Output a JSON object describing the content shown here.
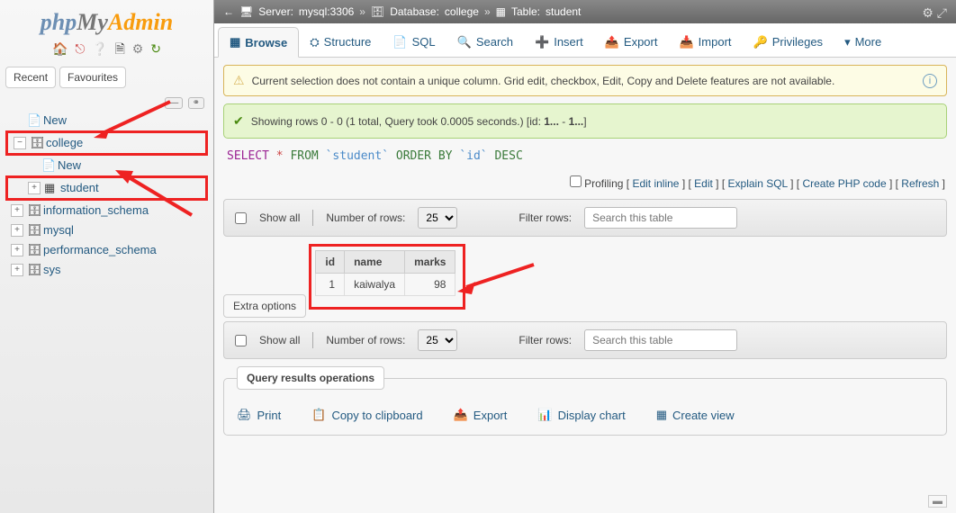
{
  "logo": {
    "p1": "php",
    "p2": "My",
    "p3": "Admin"
  },
  "sidebar_tabs": {
    "recent": "Recent",
    "favourites": "Favourites"
  },
  "tree": {
    "new": "New",
    "college": "college",
    "college_new": "New",
    "student": "student",
    "info_schema": "information_schema",
    "mysql": "mysql",
    "perf_schema": "performance_schema",
    "sys": "sys"
  },
  "breadcrumb": {
    "server_label": "Server:",
    "server_value": "mysql:3306",
    "db_label": "Database:",
    "db_value": "college",
    "tbl_label": "Table:",
    "tbl_value": "student",
    "sep": "»"
  },
  "tabs": {
    "browse": "Browse",
    "structure": "Structure",
    "sql": "SQL",
    "search": "Search",
    "insert": "Insert",
    "export": "Export",
    "import": "Import",
    "privileges": "Privileges",
    "more": "More"
  },
  "warn_msg": "Current selection does not contain a unique column. Grid edit, checkbox, Edit, Copy and Delete features are not available.",
  "ok_msg": {
    "pre": "Showing rows 0 - 0 (1 total, Query took 0.0005 seconds.) [id: ",
    "b1": "1...",
    "mid": " - ",
    "b2": "1...",
    "post": "]"
  },
  "sql": {
    "select": "SELECT",
    "star": "*",
    "from": "FROM",
    "tbl": "`student`",
    "orderby": "ORDER BY",
    "col": "`id`",
    "desc": "DESC"
  },
  "links": {
    "profiling": "Profiling",
    "edit_inline": "Edit inline",
    "edit": "Edit",
    "explain": "Explain SQL",
    "php": "Create PHP code",
    "refresh": "Refresh"
  },
  "controls": {
    "show_all": "Show all",
    "num_rows": "Number of rows:",
    "rows_val": "25",
    "filter_label": "Filter rows:",
    "filter_ph": "Search this table"
  },
  "extra_options": "Extra options",
  "table": {
    "headers": [
      "id",
      "name",
      "marks"
    ],
    "rows": [
      {
        "id": "1",
        "name": "kaiwalya",
        "marks": "98"
      }
    ]
  },
  "qops": {
    "legend": "Query results operations",
    "print": "Print",
    "clip": "Copy to clipboard",
    "export": "Export",
    "chart": "Display chart",
    "view": "Create view"
  }
}
